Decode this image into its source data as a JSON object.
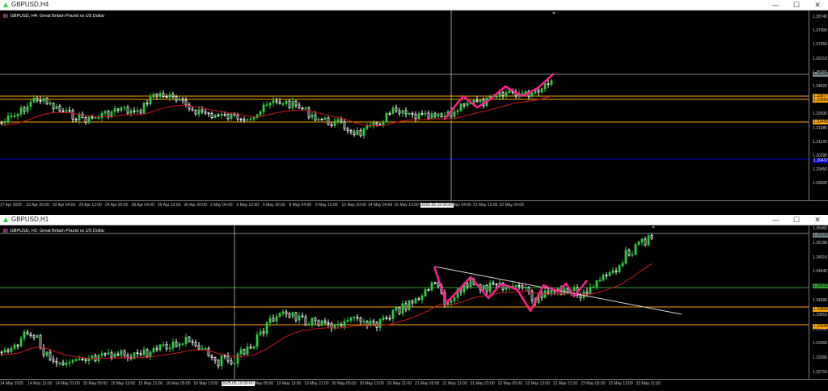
{
  "windows": [
    {
      "title": "GBPUSD,H4",
      "symbol_line": "GBPUSD, H4: Great Britain Pound vs US Dollar",
      "price_labels": [
        "1.38745",
        "1.37900",
        "1.37055",
        "1.36210",
        "1.35365",
        "1.34520",
        "1.33675",
        "1.32830",
        "1.31985",
        "1.31140",
        "1.30295",
        "1.29450",
        "1.28605"
      ],
      "highlight_prices": [
        {
          "value": "1.35394",
          "bg": "#7b8b8b",
          "fg": "#000"
        },
        {
          "value": "1.33877",
          "bg": "#ffa500",
          "fg": "#000"
        },
        {
          "value": "1.33656",
          "bg": "#ffa500",
          "fg": "#000"
        },
        {
          "value": "1.32445",
          "bg": "#ffa500",
          "fg": "#000"
        },
        {
          "value": "1.30437",
          "bg": "#0000cc",
          "fg": "#fff"
        }
      ],
      "time_labels": [
        "17 Apr 2025",
        "22 Apr 20:00",
        "22 Apr 04:00",
        "23 Apr 12:00",
        "24 Apr 20:00",
        "28 Apr 04:00",
        "29 Apr 12:00",
        "30 Apr 20:00",
        "2 May 04:00",
        "5 May 12:00",
        "6 May 20:00",
        "8 May 04:00",
        "9 May 12:00",
        "12 May 20:00",
        "14 May 04:00",
        "15 May 12:00",
        "2025.05.19 00:00",
        "20 May 04:00",
        "21 May 12:00",
        "22 May 20:00"
      ],
      "crosshair_time": "2025.05.19 00:00"
    },
    {
      "title": "GBPUSD,H1",
      "symbol_line": "GBPUSD, H1: Great Britain Pound vs US Dollar",
      "price_labels": [
        "1.35465",
        "1.35190",
        "1.34915",
        "1.34640",
        "1.34365",
        "1.34090",
        "1.33815",
        "1.33540",
        "1.33265",
        "1.32990",
        "1.32715"
      ],
      "highlight_prices": [
        {
          "value": "1.35318",
          "bg": "#7b8b8b",
          "fg": "#000"
        },
        {
          "value": "1.34233",
          "bg": "#2ea02e",
          "fg": "#000"
        },
        {
          "value": "1.33868",
          "bg": "#ffa500",
          "fg": "#000"
        },
        {
          "value": "1.33544",
          "bg": "#ffa500",
          "fg": "#000"
        }
      ],
      "time_labels": [
        "14 May 2025",
        "14 May 13:00",
        "14 May 21:00",
        "15 May 05:00",
        "15 May 13:00",
        "15 May 21:00",
        "16 May 05:00",
        "16 May 13:00",
        "2025.05.19 00:00",
        "19 May 05:00",
        "19 May 13:00",
        "19 May 21:00",
        "20 May 05:00",
        "20 May 13:00",
        "20 May 21:00",
        "21 May 05:00",
        "21 May 13:00",
        "21 May 21:00",
        "22 May 05:00",
        "22 May 13:00",
        "22 May 21:00",
        "23 May 05:00",
        "23 May 13:00",
        "23 May 21:00"
      ],
      "crosshair_time": "2025.05.19 00:00"
    }
  ],
  "window_controls": {
    "minimize": "—",
    "maximize": "☐",
    "close": "✕"
  },
  "colors": {
    "bull": "#2ecc40",
    "bear": "#ffffff",
    "ma": "#d01818",
    "pattern": "#ff1f8f",
    "hline_gray": "#7b8b8b",
    "hline_orange": "#ffa500",
    "hline_blue": "#0000cc",
    "hline_green": "#2ea02e",
    "trendline": "#d8d8d8"
  },
  "icons": {
    "app": "chart-window-icon",
    "symbol": "symbol-flag-icon"
  }
}
